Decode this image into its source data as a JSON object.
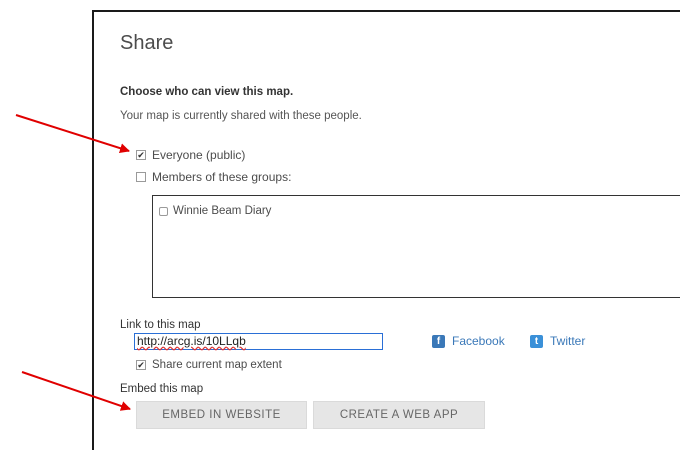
{
  "dialog": {
    "title": "Share",
    "heading": "Choose who can view this map.",
    "subtext": "Your map is currently shared with these people.",
    "everyone_label": "Everyone (public)",
    "everyone_checked": true,
    "groups_label": "Members of these groups:",
    "groups_checked": false,
    "groups": [
      {
        "name": "Winnie Beam Diary",
        "checked": false
      }
    ],
    "link_label": "Link to this map",
    "link_value": "http://arcg.is/10LLqb",
    "facebook_label": "Facebook",
    "twitter_label": "Twitter",
    "share_extent_label": "Share current map extent",
    "share_extent_checked": true,
    "embed_label": "Embed this map",
    "embed_button": "EMBED IN WEBSITE",
    "webapp_button": "CREATE A WEB APP"
  },
  "colors": {
    "annotation_arrow": "#e00000",
    "link_blue": "#3a78b8",
    "input_border": "#2a6fd6"
  }
}
